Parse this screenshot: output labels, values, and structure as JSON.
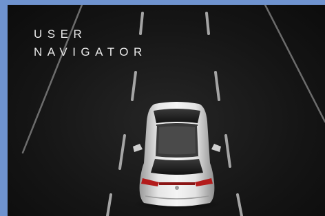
{
  "brand": {
    "line1": "USER",
    "line2": "NAVIGATOR"
  },
  "scene": {
    "description_icon": "car-top-view-icon",
    "background_color": "#151515",
    "frame_color": "#6f93cf",
    "lane_color": "#bdbdbd"
  }
}
